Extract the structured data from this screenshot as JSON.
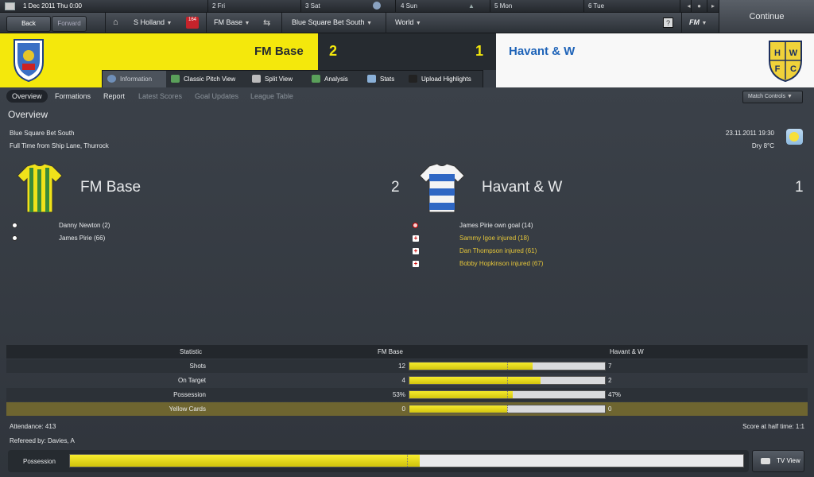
{
  "datebar": {
    "today": "1 Dec 2011 Thu 0:00",
    "days": [
      "2 Fri",
      "3 Sat",
      "4 Sun",
      "5 Mon",
      "6 Tue"
    ]
  },
  "nav": {
    "back": "Back",
    "forward": "Forward",
    "manager": "S Holland",
    "inbox_badge": "164",
    "club": "FM Base",
    "competition": "Blue Square Bet South",
    "world": "World",
    "help": "?",
    "fm_menu": "FM",
    "continue": "Continue"
  },
  "banner": {
    "home_name": "FM Base",
    "home_score": "2",
    "away_score": "1",
    "away_name": "Havant & W",
    "away_crest_letters": "HWFC"
  },
  "subtabs": [
    "Information",
    "Classic Pitch View",
    "Split View",
    "Analysis",
    "Stats",
    "Upload Highlights"
  ],
  "pills": [
    "Overview",
    "Formations",
    "Report",
    "Latest Scores",
    "Goal Updates",
    "League Table"
  ],
  "match_controls": "Match Controls",
  "overview": {
    "title": "Overview",
    "competition": "Blue Square Bet South",
    "venue": "Full Time from Ship Lane, Thurrock",
    "datetime": "23.11.2011 19:30",
    "weather": "Dry 8°C",
    "home_team": "FM Base",
    "home_goals": "2",
    "away_team": "Havant & W",
    "away_goals": "1",
    "home_events": [
      "Danny Newton (2)",
      "James Pirie (66)"
    ],
    "away_events": [
      "James Pirie own goal (14)",
      "Sammy Igoe injured (18)",
      "Dan Thompson injured (61)",
      "Bobby Hopkinson injured (67)"
    ]
  },
  "stats": {
    "header": [
      "Statistic",
      "FM Base",
      "Havant & W"
    ],
    "rows": [
      {
        "label": "Shots",
        "home": "12",
        "away": "7",
        "home_share": 0.63
      },
      {
        "label": "On Target",
        "home": "4",
        "away": "2",
        "home_share": 0.67
      },
      {
        "label": "Possession",
        "home": "53%",
        "away": "47%",
        "home_share": 0.53
      },
      {
        "label": "Yellow Cards",
        "home": "0",
        "away": "0",
        "home_share": 0.5
      }
    ]
  },
  "footer": {
    "attendance": "Attendance: 413",
    "halftime": "Score at half time: 1:1",
    "referee": "Refereed by: Davies, A",
    "possession_label": "Possession",
    "possession_home_share": 0.52,
    "tv_view": "TV View"
  },
  "colors": {
    "home": "#f4e80c",
    "away_text": "#1e63b8",
    "injury": "#e5c63a"
  }
}
